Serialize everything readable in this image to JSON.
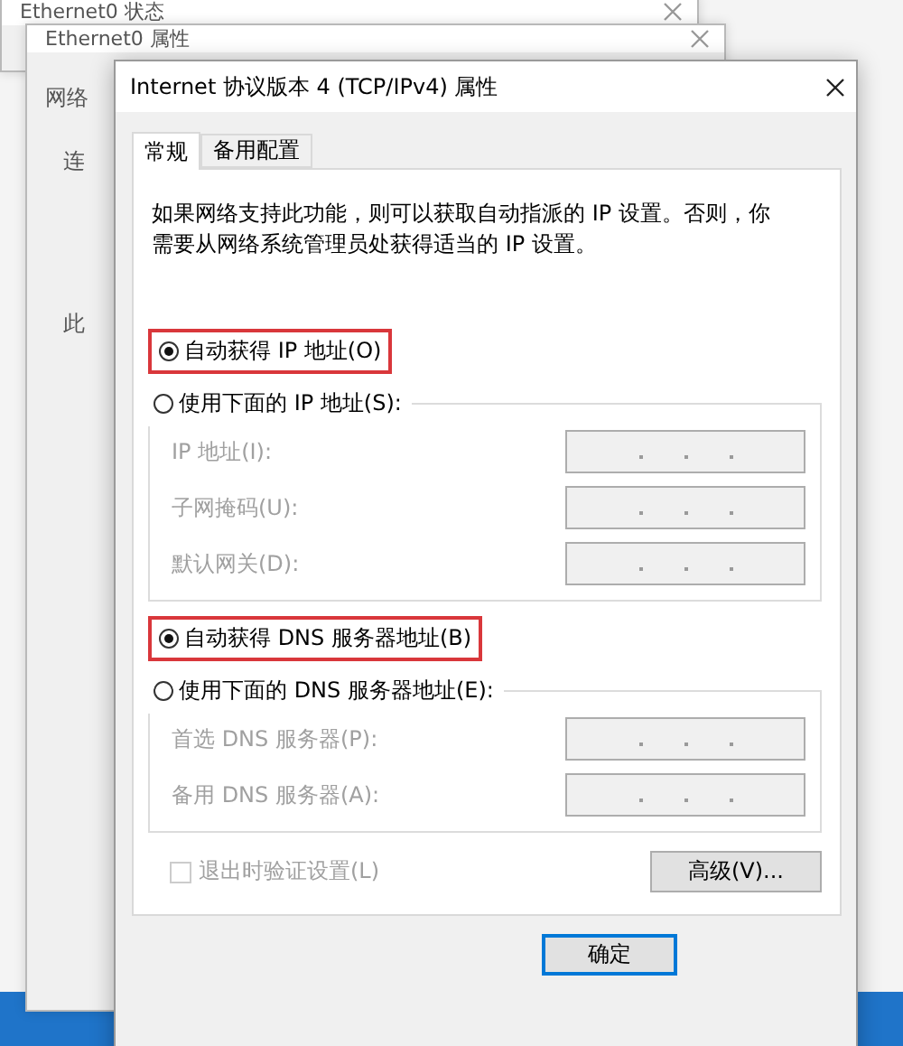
{
  "background_windows": [
    {
      "title": "Ethernet0 状态"
    },
    {
      "title": "Ethernet0 属性",
      "fragments": [
        "网络",
        "连",
        "此"
      ]
    }
  ],
  "dialog": {
    "title": "Internet 协议版本 4 (TCP/IPv4) 属性"
  },
  "tabs": [
    {
      "label": "常规",
      "selected": true
    },
    {
      "label": "备用配置",
      "selected": false
    }
  ],
  "description": "如果网络支持此功能，则可以获取自动指派的 IP 设置。否则，你需要从网络系统管理员处获得适当的 IP 设置。",
  "sections": [
    {
      "auto": {
        "label": "自动获得 IP 地址(O)",
        "selected": true,
        "highlighted": true
      },
      "manual": {
        "label": "使用下面的 IP 地址(S):",
        "selected": false
      },
      "fields": [
        {
          "label": "IP 地址(I):",
          "disabled": true
        },
        {
          "label": "子网掩码(U):",
          "disabled": true
        },
        {
          "label": "默认网关(D):",
          "disabled": true
        }
      ]
    },
    {
      "auto": {
        "label": "自动获得 DNS 服务器地址(B)",
        "selected": true,
        "highlighted": true
      },
      "manual": {
        "label": "使用下面的 DNS 服务器地址(E):",
        "selected": false
      },
      "fields": [
        {
          "label": "首选 DNS 服务器(P):",
          "disabled": true
        },
        {
          "label": "备用 DNS 服务器(A):",
          "disabled": true
        }
      ]
    }
  ],
  "validate": {
    "label": "退出时验证设置(L)",
    "checked": false,
    "disabled": true
  },
  "advanced_button": "高级(V)...",
  "ok_button": "确定"
}
